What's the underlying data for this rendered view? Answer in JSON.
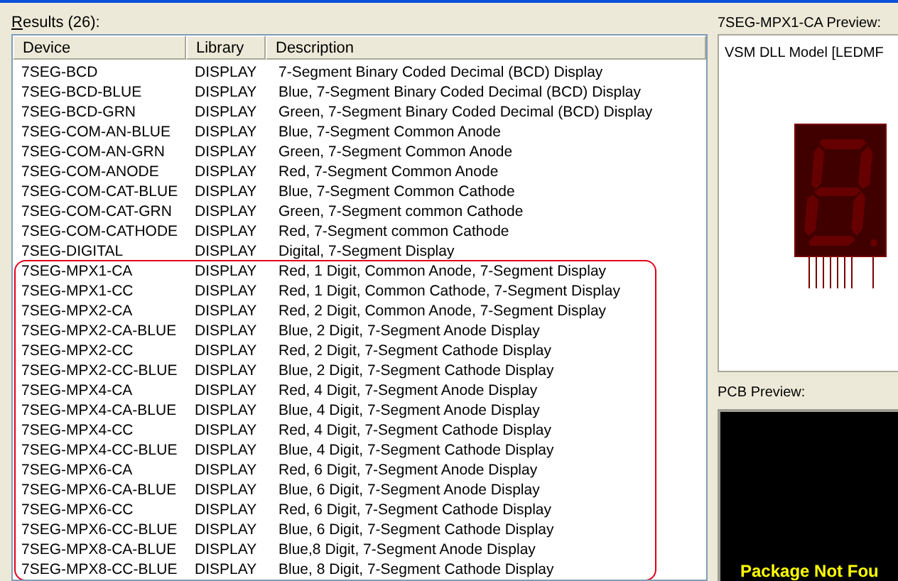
{
  "results_label": "Results (26):",
  "table": {
    "columns": [
      "Device",
      "Library",
      "Description"
    ],
    "rows": [
      {
        "cells": [
          "7SEG-BCD",
          "DISPLAY",
          "7-Segment Binary Coded Decimal (BCD) Display"
        ],
        "circled": false
      },
      {
        "cells": [
          "7SEG-BCD-BLUE",
          "DISPLAY",
          "Blue,  7-Segment Binary Coded Decimal (BCD) Display"
        ],
        "circled": false
      },
      {
        "cells": [
          "7SEG-BCD-GRN",
          "DISPLAY",
          "Green, 7-Segment Binary Coded Decimal (BCD) Display"
        ],
        "circled": false
      },
      {
        "cells": [
          "7SEG-COM-AN-BLUE",
          "DISPLAY",
          "Blue, 7-Segment Common Anode"
        ],
        "circled": false
      },
      {
        "cells": [
          "7SEG-COM-AN-GRN",
          "DISPLAY",
          "Green, 7-Segment Common Anode"
        ],
        "circled": false
      },
      {
        "cells": [
          "7SEG-COM-ANODE",
          "DISPLAY",
          "Red, 7-Segment Common Anode"
        ],
        "circled": false
      },
      {
        "cells": [
          "7SEG-COM-CAT-BLUE",
          "DISPLAY",
          "Blue, 7-Segment Common Cathode"
        ],
        "circled": false
      },
      {
        "cells": [
          "7SEG-COM-CAT-GRN",
          "DISPLAY",
          "Green, 7-Segment common Cathode"
        ],
        "circled": false
      },
      {
        "cells": [
          "7SEG-COM-CATHODE",
          "DISPLAY",
          "Red, 7-Segment common Cathode"
        ],
        "circled": false
      },
      {
        "cells": [
          "7SEG-DIGITAL",
          "DISPLAY",
          "Digital, 7-Segment Display"
        ],
        "circled": false
      },
      {
        "cells": [
          "7SEG-MPX1-CA",
          "DISPLAY",
          "Red, 1 Digit, Common Anode, 7-Segment Display"
        ],
        "circled": true
      },
      {
        "cells": [
          "7SEG-MPX1-CC",
          "DISPLAY",
          "Red, 1 Digit, Common Cathode, 7-Segment Display"
        ],
        "circled": true
      },
      {
        "cells": [
          "7SEG-MPX2-CA",
          "DISPLAY",
          "Red, 2 Digit, Common Anode, 7-Segment Display"
        ],
        "circled": true
      },
      {
        "cells": [
          "7SEG-MPX2-CA-BLUE",
          "DISPLAY",
          "Blue, 2 Digit, 7-Segment Anode Display"
        ],
        "circled": true
      },
      {
        "cells": [
          "7SEG-MPX2-CC",
          "DISPLAY",
          "Red, 2 Digit, 7-Segment Cathode Display"
        ],
        "circled": true
      },
      {
        "cells": [
          "7SEG-MPX2-CC-BLUE",
          "DISPLAY",
          "Blue, 2 Digit, 7-Segment Cathode Display"
        ],
        "circled": true
      },
      {
        "cells": [
          "7SEG-MPX4-CA",
          "DISPLAY",
          "Red, 4 Digit, 7-Segment Anode Display"
        ],
        "circled": true
      },
      {
        "cells": [
          "7SEG-MPX4-CA-BLUE",
          "DISPLAY",
          "Blue, 4 Digit, 7-Segment Anode Display"
        ],
        "circled": true
      },
      {
        "cells": [
          "7SEG-MPX4-CC",
          "DISPLAY",
          "Red, 4 Digit, 7-Segment Cathode Display"
        ],
        "circled": true
      },
      {
        "cells": [
          "7SEG-MPX4-CC-BLUE",
          "DISPLAY",
          "Blue, 4 Digit, 7-Segment Cathode Display"
        ],
        "circled": true
      },
      {
        "cells": [
          "7SEG-MPX6-CA",
          "DISPLAY",
          "Red, 6 Digit, 7-Segment Anode Display"
        ],
        "circled": true
      },
      {
        "cells": [
          "7SEG-MPX6-CA-BLUE",
          "DISPLAY",
          "Blue, 6 Digit, 7-Segment Anode Display"
        ],
        "circled": true
      },
      {
        "cells": [
          "7SEG-MPX6-CC",
          "DISPLAY",
          "Red, 6 Digit, 7-Segment Cathode Display"
        ],
        "circled": true
      },
      {
        "cells": [
          "7SEG-MPX6-CC-BLUE",
          "DISPLAY",
          "Blue, 6 Digit, 7-Segment Cathode Display"
        ],
        "circled": true
      },
      {
        "cells": [
          "7SEG-MPX8-CA-BLUE",
          "DISPLAY",
          "Blue,8 Digit, 7-Segment Anode Display"
        ],
        "circled": true
      },
      {
        "cells": [
          "7SEG-MPX8-CC-BLUE",
          "DISPLAY",
          "Blue, 8 Digit, 7-Segment Cathode Display"
        ],
        "circled": true
      }
    ]
  },
  "preview": {
    "title": "7SEG-MPX1-CA Preview:",
    "model_text": "VSM DLL Model [LEDMF"
  },
  "pcb_preview": {
    "title": "PCB Preview:",
    "message": "Package Not Fou"
  }
}
